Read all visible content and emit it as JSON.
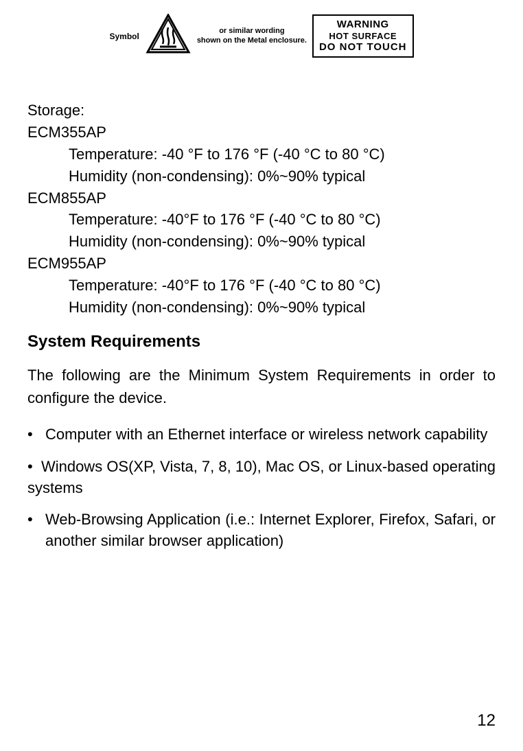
{
  "warning": {
    "symbol_label": "Symbol",
    "caption_line1": "or similar wording",
    "caption_line2": "shown on the Metal enclosure.",
    "box_line1": "WARNING",
    "box_line2": "HOT SURFACE",
    "box_line3": "DO NOT TOUCH"
  },
  "storage": {
    "heading": "Storage:",
    "models": [
      {
        "name": "ECM355AP",
        "temperature": "Temperature: -40 °F to 176 °F (-40 °C to 80 °C)",
        "humidity": "Humidity (non-condensing): 0%~90% typical"
      },
      {
        "name": "ECM855AP",
        "temperature": "Temperature: -40°F to 176 °F (-40 °C to 80 °C)",
        "humidity": "Humidity (non-condensing): 0%~90% typical"
      },
      {
        "name": "ECM955AP",
        "temperature": "Temperature: -40°F to 176 °F (-40 °C to 80 °C)",
        "humidity": "Humidity (non-condensing): 0%~90% typical"
      }
    ]
  },
  "system_requirements": {
    "heading": "System Requirements",
    "intro": "The following are the Minimum System Requirements in order to configure the device.",
    "bullets": [
      "Computer with an Ethernet interface or wireless network capability",
      "Windows OS(XP, Vista, 7, 8, 10), Mac OS, or Linux-based operating systems",
      "Web-Browsing Application (i.e.: Internet Explorer, Firefox, Safari, or another similar browser application)"
    ]
  },
  "page_number": "12"
}
